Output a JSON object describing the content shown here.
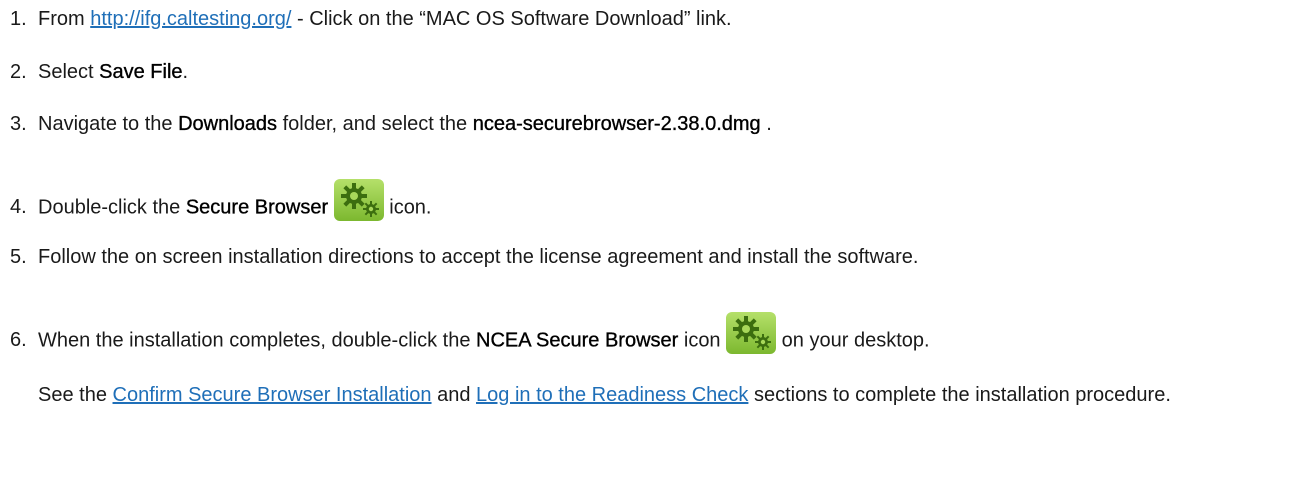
{
  "steps": [
    {
      "number": "1.",
      "pre": "From ",
      "link": "http://ifg.caltesting.org/",
      "post": "  - Click on the “MAC OS Software Download” link."
    },
    {
      "number": "2.",
      "pre": "Select ",
      "bold": "Save File",
      "post": "."
    },
    {
      "number": "3.",
      "pre": "Navigate to the ",
      "bold1": "Downloads",
      "mid": " folder, and select the ",
      "bold2": "ncea-securebrowser-2.38.0.dmg",
      "post": " ."
    },
    {
      "number": "4.",
      "pre": "Double-click the ",
      "bold": "Secure Browser",
      "post": " icon.",
      "icon": "secure-browser-gear-icon"
    },
    {
      "number": "5.",
      "text": "Follow the on screen installation directions to accept the license agreement and install the software."
    },
    {
      "number": "6.",
      "pre": "When the installation completes, double-click the ",
      "bold": "NCEA Secure Browser",
      "mid": " icon ",
      "post": " on your desktop.",
      "icon": "secure-browser-gear-icon"
    }
  ],
  "note": {
    "pre": "See the ",
    "link1": "Confirm Secure Browser Installation",
    "mid": " and ",
    "link2": "Log in to the Readiness Check",
    "post": " sections to complete the installation procedure."
  },
  "colors": {
    "link": "#1f6fb8",
    "icon_bg": "#8cc63f",
    "icon_gear": "#3c6e0f"
  }
}
